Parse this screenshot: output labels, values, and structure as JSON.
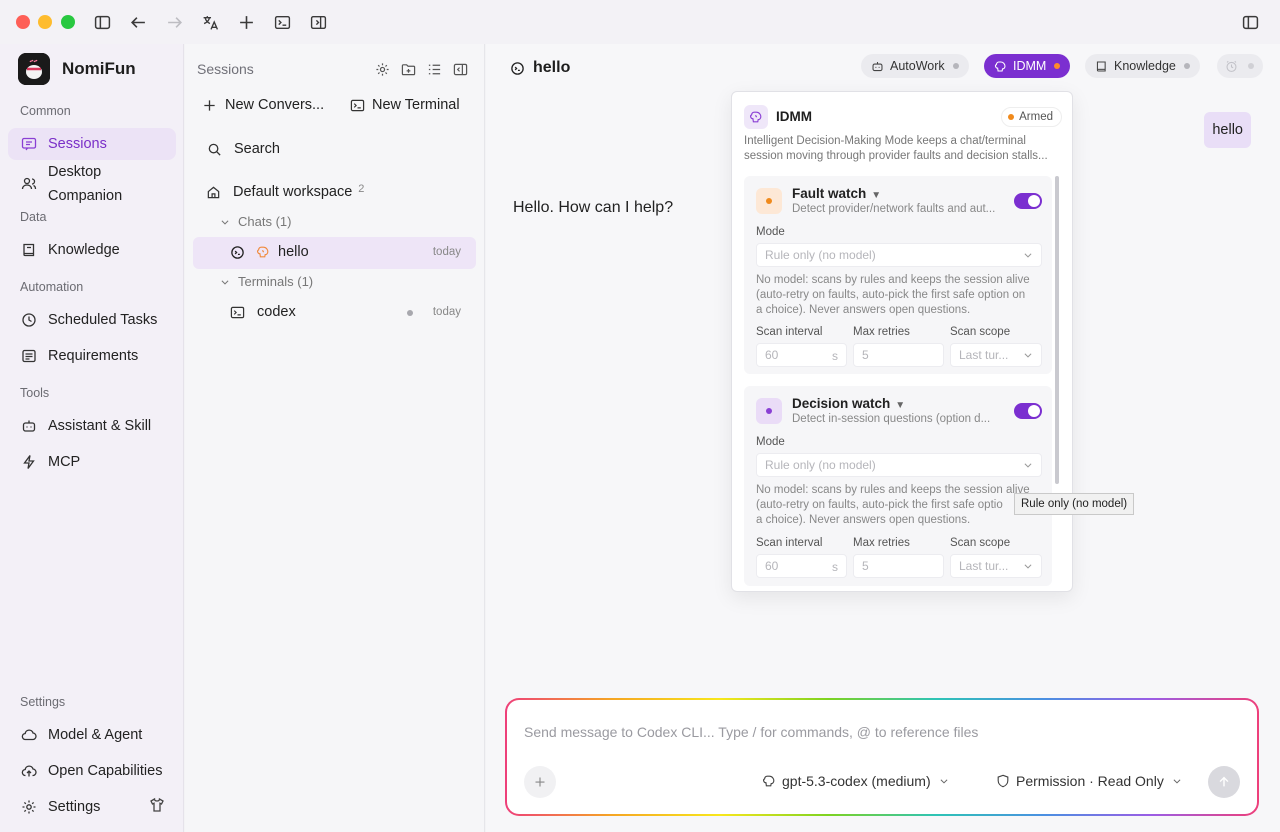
{
  "sidebar": {
    "app_name": "NomiFun",
    "sections": {
      "common": "Common",
      "data": "Data",
      "automation": "Automation",
      "tools": "Tools",
      "settings": "Settings"
    },
    "items": {
      "sessions": "Sessions",
      "desktop_companion_1": "Desktop",
      "desktop_companion_2": "Companion",
      "knowledge": "Knowledge",
      "scheduled_tasks": "Scheduled Tasks",
      "requirements": "Requirements",
      "assistant_skill": "Assistant & Skill",
      "mcp": "MCP",
      "model_agent": "Model & Agent",
      "open_capabilities": "Open Capabilities",
      "settings": "Settings"
    },
    "accent_color": "#8a3fd4"
  },
  "sessions_panel": {
    "title": "Sessions",
    "new_conversation": "New Convers...",
    "new_terminal": "New Terminal",
    "search": "Search",
    "workspace": {
      "name": "Default workspace",
      "count": "2"
    },
    "chats_group": "Chats (1)",
    "chat_item": {
      "title": "hello",
      "time": "today"
    },
    "terminals_group": "Terminals (1)",
    "terminal_item": {
      "title": "codex",
      "time": "today"
    }
  },
  "main": {
    "chat_title": "hello",
    "chips": {
      "autowork": "AutoWork",
      "idmm": "IDMM",
      "knowledge": "Knowledge"
    },
    "user_message": "hello",
    "assistant_message": "Hello. How can I help?"
  },
  "idmm_popover": {
    "title": "IDMM",
    "status": "Armed",
    "desc_line1": "Intelligent Decision-Making Mode keeps a chat/terminal",
    "desc_line2": "session moving through provider faults and decision stalls...",
    "fault_watch": {
      "title": "Fault watch",
      "caret": "▼",
      "subtitle": "Detect provider/network faults and aut...",
      "enabled": true,
      "mode_label": "Mode",
      "mode_value": "Rule only (no model)",
      "note_line1": "No model: scans by rules and keeps the session alive",
      "note_line2": "(auto-retry on faults, auto-pick the first safe option on",
      "note_line3": "a choice). Never answers open questions.",
      "scan_interval_label": "Scan interval",
      "scan_interval_value": "60",
      "scan_interval_unit": "s",
      "max_retries_label": "Max retries",
      "max_retries_value": "5",
      "scan_scope_label": "Scan scope",
      "scan_scope_value": "Last tur..."
    },
    "decision_watch": {
      "title": "Decision watch",
      "caret": "▼",
      "subtitle": "Detect in-session questions (option d...",
      "enabled": true,
      "mode_label": "Mode",
      "mode_value": "Rule only (no model)",
      "note_line1": "No model: scans by rules and keeps the session alive",
      "note_line2": "(auto-retry on faults, auto-pick the first safe optio",
      "note_line3": "a choice). Never answers open questions.",
      "scan_interval_label": "Scan interval",
      "scan_interval_value": "60",
      "scan_interval_unit": "s",
      "max_retries_label": "Max retries",
      "max_retries_value": "5",
      "scan_scope_label": "Scan scope",
      "scan_scope_value": "Last tur..."
    },
    "tooltip": "Rule only (no model)"
  },
  "composer": {
    "placeholder": "Send message to Codex CLI...  Type / for commands, @ to reference files",
    "model": "gpt-5.3-codex (medium)",
    "permission": "Permission · Read Only"
  }
}
